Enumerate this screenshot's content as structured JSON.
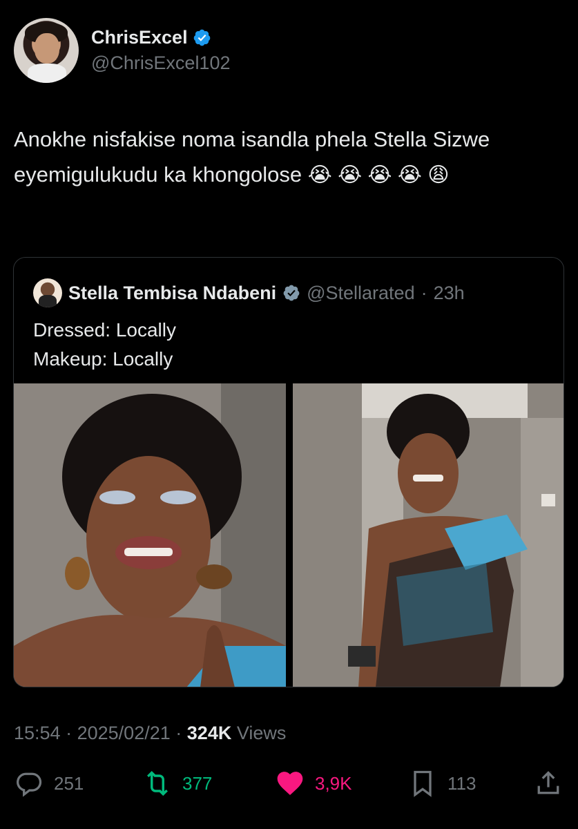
{
  "author": {
    "display_name": "ChrisExcel",
    "handle": "@ChrisExcel102",
    "verified": true
  },
  "tweet": {
    "text": "Anokhe nisfakise noma isandla phela Stella Sizwe eyemigulukudu ka khongolose",
    "emojis": "😭 😭 😭 😭 😩"
  },
  "quote": {
    "display_name": "Stella Tembisa Ndabeni",
    "handle": "@Stellarated",
    "separator": "·",
    "time": "23h",
    "line_1": "Dressed: Locally",
    "line_2": "Makeup: Locally"
  },
  "meta": {
    "time": "15:54",
    "date": "2025/02/21",
    "views_count": "324K",
    "views_label": "Views"
  },
  "actions": {
    "replies": "251",
    "retweets": "377",
    "likes": "3,9K",
    "bookmarks": "113"
  },
  "colors": {
    "background": "#000000",
    "text": "#e7e9ea",
    "muted": "#71767b",
    "verified": "#1d9bf0",
    "retweet": "#00ba7c",
    "like": "#f91880",
    "border": "#2f3336"
  }
}
